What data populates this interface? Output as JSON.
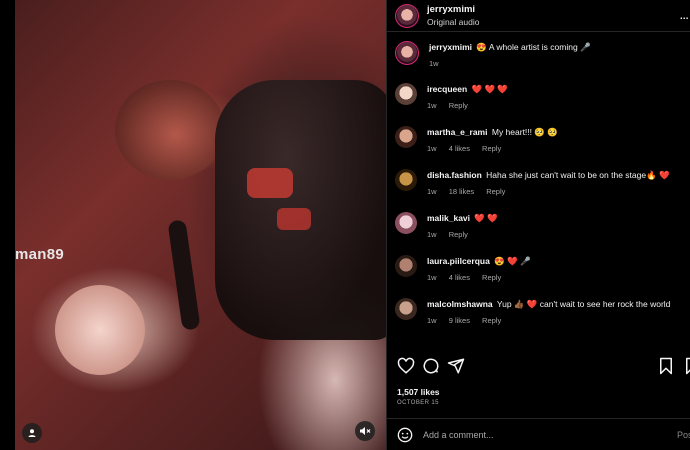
{
  "post": {
    "username": "jerryxmimi",
    "audio": "Original audio",
    "more_label": "...",
    "caption_text": "😍 A whole artist is coming 🎤",
    "caption_time": "1w",
    "likes": "1,507 likes",
    "date": "OCTOBER 15"
  },
  "video": {
    "watermark": "man89"
  },
  "comments": [
    {
      "user": "irecqueen",
      "text": "❤️ ❤️ ❤️",
      "time": "1w",
      "likes": "",
      "reply": "Reply"
    },
    {
      "user": "martha_e_rami",
      "text": "My heart!!! 🥺 🥺",
      "time": "1w",
      "likes": "4 likes",
      "reply": "Reply"
    },
    {
      "user": "disha.fashion",
      "text": "Haha she just can't wait to be on the stage🔥 ❤️",
      "time": "1w",
      "likes": "18 likes",
      "reply": "Reply"
    },
    {
      "user": "malik_kavi",
      "text": "❤️ ❤️",
      "time": "1w",
      "likes": "",
      "reply": "Reply"
    },
    {
      "user": "laura.piilcerqua",
      "text": "😍 ❤️ 🎤",
      "time": "1w",
      "likes": "4 likes",
      "reply": "Reply"
    },
    {
      "user": "malcolmshawna",
      "text": "Yup 👍🏾 ❤️ can't wait to see her rock the world",
      "time": "1w",
      "likes": "9 likes",
      "reply": "Reply"
    }
  ],
  "composer": {
    "placeholder": "Add a comment...",
    "post_label": "Post"
  },
  "colors": {
    "heart": "#ed2d46",
    "story_ring": "#d62976"
  }
}
